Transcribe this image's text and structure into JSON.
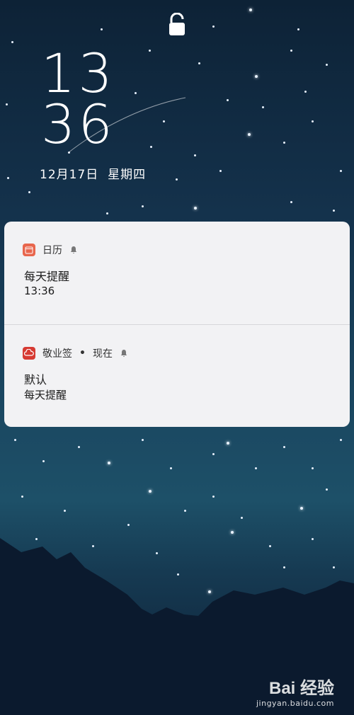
{
  "lockscreen": {
    "time_hour": "13",
    "time_minute": "36",
    "date": "12月17日  星期四"
  },
  "notifications": [
    {
      "app_name": "日历",
      "icon": "calendar-icon",
      "title": "每天提醒",
      "body": "13:36"
    },
    {
      "app_name": "敬业签",
      "separator": "•",
      "time": "现在",
      "icon": "cloud-note-icon",
      "title": "默认",
      "body": "每天提醒"
    }
  ],
  "watermark": {
    "brand": "Bai 经验",
    "url": "jingyan.baidu.com"
  },
  "colors": {
    "card_bg": "#f2f2f4",
    "calendar_icon": "#e8664d",
    "note_icon": "#d63a32"
  }
}
